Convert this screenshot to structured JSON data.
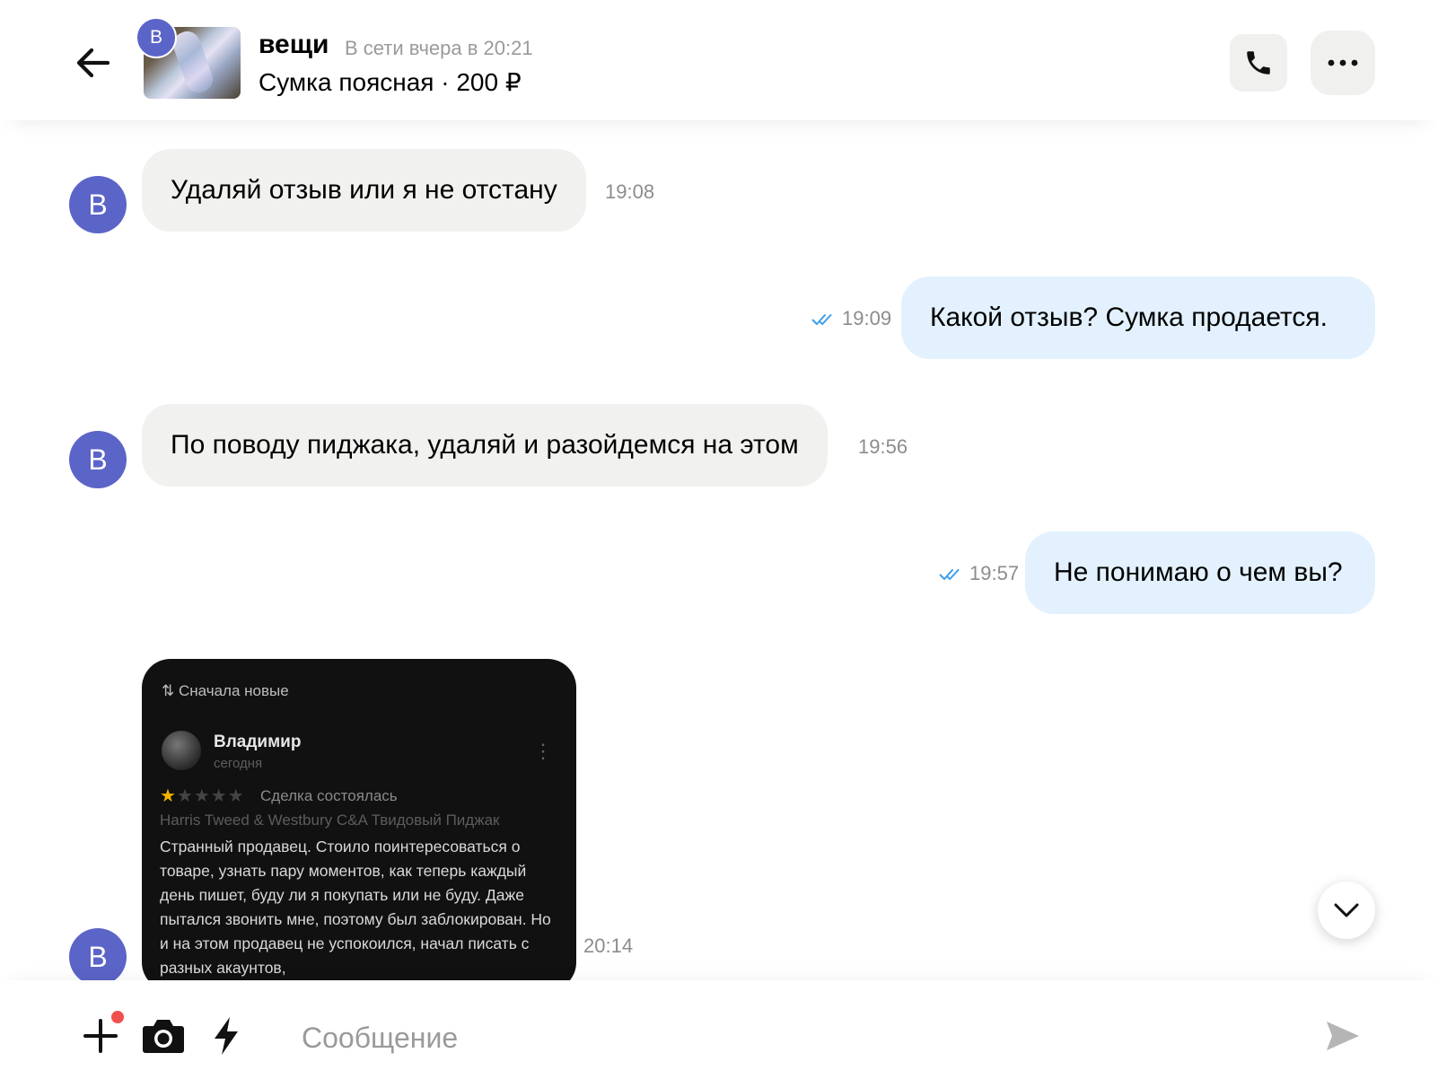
{
  "header": {
    "seller_initial": "В",
    "seller_name": "вещи",
    "seller_status": "В сети вчера в 20:21",
    "item_title": "Сумка поясная · 200 ₽",
    "icons": {
      "back": "arrow-left-icon",
      "call": "phone-icon",
      "more": "ellipsis-icon"
    }
  },
  "messages": [
    {
      "direction": "incoming",
      "avatar": "В",
      "text": "Удаляй отзыв или я не отстану",
      "time": "19:08"
    },
    {
      "direction": "outgoing",
      "text": "Какой отзыв? Сумка продается.",
      "time": "19:09",
      "status": "read"
    },
    {
      "direction": "incoming",
      "avatar": "В",
      "text": "По поводу пиджака, удаляй и разойдемся на этом",
      "time": "19:56"
    },
    {
      "direction": "outgoing",
      "text": "Не понимаю о чем вы?",
      "time": "19:57",
      "status": "read"
    }
  ],
  "image_message": {
    "avatar": "В",
    "time": "20:14",
    "screenshot": {
      "sort_label": "⇅ Сначала новые",
      "reviewer_name": "Владимир",
      "review_date": "сегодня",
      "rating": 1,
      "deal_status": "Сделка состоялась",
      "product": "Harris Tweed & Westbury C&A Твидовый Пиджак",
      "review_text": "Странный продавец. Стоило поинтересоваться о товаре, узнать пару моментов, как теперь каждый день пишет, буду ли я покупать или не буду. Даже пытался звонить мне, поэтому был заблокирован. Но и на этом продавец не успокоился, начал писать с разных акаунтов,"
    }
  },
  "composer": {
    "placeholder": "Сообщение",
    "value": "",
    "icons": {
      "add": "plus-icon",
      "camera": "camera-icon",
      "quick": "lightning-icon",
      "send": "send-icon"
    }
  },
  "colors": {
    "avatar": "#5b64c7",
    "incoming_bubble": "#f1f1ef",
    "outgoing_bubble": "#e2f1fd",
    "read_check": "#3b9eea",
    "notification_dot": "#f0504c"
  }
}
